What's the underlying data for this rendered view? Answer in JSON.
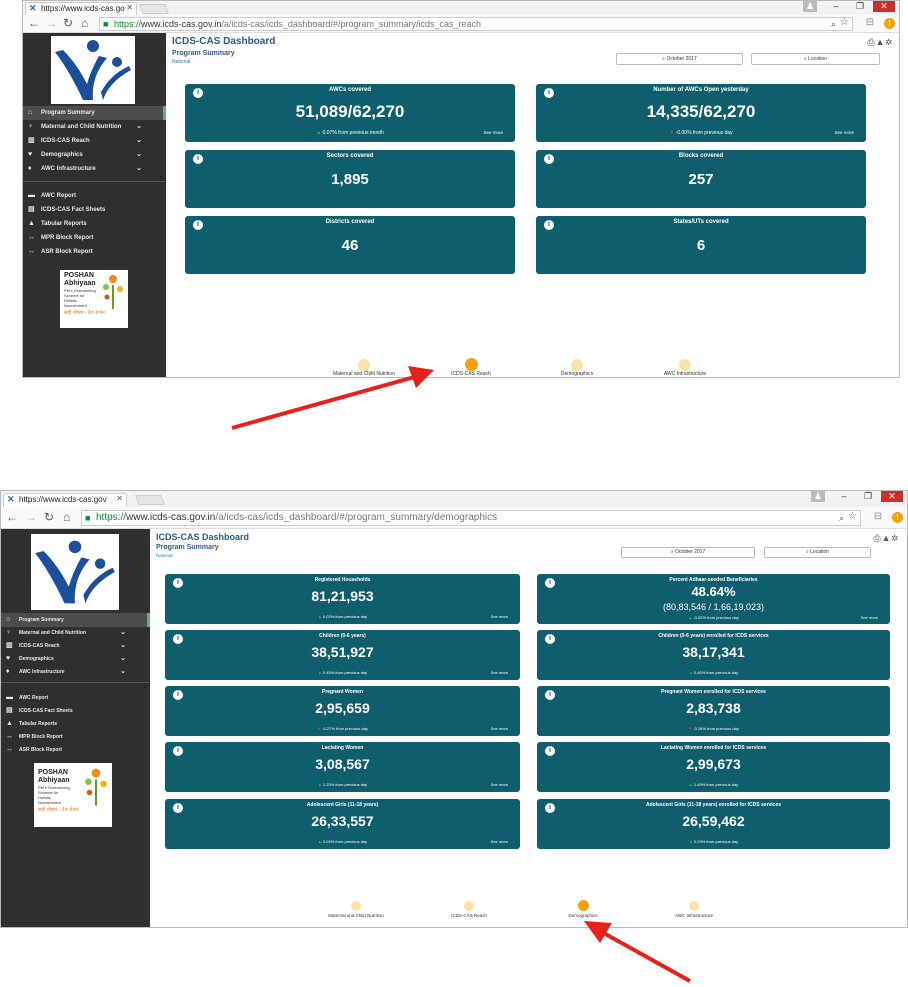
{
  "screenshots": [
    {
      "tab_title": "https://www.icds-cas.go",
      "url_https": "https://",
      "url_host": "www.icds-cas.gov.in",
      "url_path": "/a/icds-cas/icds_dashboard/#/program_summary/icds_cas_reach",
      "dashboard_title": "ICDS-CAS Dashboard",
      "section_title": "Program Summary",
      "level": "National",
      "month_filter": "October 2017",
      "location_filter": "Location",
      "cards": [
        {
          "title": "AWCs covered",
          "value": "51,089/62,270",
          "sub": "0.07% from previous month",
          "trend": "up",
          "more": "See more"
        },
        {
          "title": "Number of AWCs Open yesterday",
          "value": "14,335/62,270",
          "sub": "-0.00% from previous day",
          "trend": "down",
          "more": "See more"
        },
        {
          "title": "Sectors covered",
          "value": "1,895"
        },
        {
          "title": "Blocks covered",
          "value": "257"
        },
        {
          "title": "Districts covered",
          "value": "46"
        },
        {
          "title": "States/UTs covered",
          "value": "6"
        }
      ],
      "bubbles": [
        "Maternal and Child Nutrition",
        "ICDS-CAS Reach",
        "Demographics",
        "AWC Infrastructure"
      ],
      "active_bubble": 1
    },
    {
      "tab_title": "https://www.icds-cas.gov",
      "url_https": "https://",
      "url_host": "www.icds-cas.gov.in",
      "url_path": "/a/icds-cas/icds_dashboard/#/program_summary/demographics",
      "dashboard_title": "ICDS-CAS Dashboard",
      "section_title": "Program Summary",
      "level": "National",
      "month_filter": "October 2017",
      "location_filter": "Location",
      "cards": [
        {
          "title": "Registered Households",
          "value": "81,21,953",
          "sub": "0.02% from previous day",
          "trend": "up",
          "more": "See more"
        },
        {
          "title": "Percent Adhaar-seeded Beneficiaries",
          "value": "48.64%",
          "extra": "(80,83,546 / 1,66,19,023)",
          "sub": "-0.02% from previous day",
          "trend": "up",
          "more": "See more"
        },
        {
          "title": "Children (0-6 years)",
          "value": "38,51,927",
          "sub": "0.45% from previous day",
          "trend": "up",
          "more": "See more"
        },
        {
          "title": "Children (0-6 years) enrolled for ICDS services",
          "value": "38,17,341",
          "sub": "0.46% from previous day",
          "trend": "up"
        },
        {
          "title": "Pregnant Women",
          "value": "2,95,659",
          "sub": "-0.27% from previous day",
          "trend": "down",
          "more": "See more"
        },
        {
          "title": "Pregnant Women enrolled for ICDS services",
          "value": "2,83,738",
          "sub": "-0.26% from previous day",
          "trend": "down"
        },
        {
          "title": "Lactating Women",
          "value": "3,08,567",
          "sub": "1.23% from previous day",
          "trend": "up",
          "more": "See more"
        },
        {
          "title": "Lactating Women enrolled for ICDS services",
          "value": "2,99,673",
          "sub": "1.49% from previous day",
          "trend": "up"
        },
        {
          "title": "Adolescent Girls (11-18 years)",
          "value": "26,33,557",
          "sub": "0.03% from previous day",
          "trend": "up",
          "more": "See more"
        },
        {
          "title": "Adolescent Girls (11-18 years) enrolled for ICDS services",
          "value": "26,59,462",
          "sub": "0.03% from previous day",
          "trend": "up"
        }
      ],
      "bubbles": [
        "Maternal and Child Nutrition",
        "ICDS-CAS Reach",
        "Demographics",
        "AWC Infrastructure"
      ],
      "active_bubble": 2
    }
  ],
  "sidebar": {
    "items": [
      {
        "label": "Program Summary",
        "icon": "home-icon",
        "glyph": "⌂",
        "chevron": false
      },
      {
        "label": "Maternal and Child Nutrition",
        "icon": "child-icon",
        "glyph": "♀",
        "chevron": true
      },
      {
        "label": "ICDS-CAS Reach",
        "icon": "bar-chart-icon",
        "glyph": "▥",
        "chevron": true
      },
      {
        "label": "Demographics",
        "icon": "users-icon",
        "glyph": "♥",
        "chevron": true
      },
      {
        "label": "AWC Infrastructure",
        "icon": "pin-icon",
        "glyph": "♦",
        "chevron": true
      }
    ],
    "reports": [
      {
        "label": "AWC Report",
        "icon": "report-icon",
        "glyph": "▬"
      },
      {
        "label": "ICDS-CAS Fact Sheets",
        "icon": "file-icon",
        "glyph": "▤"
      },
      {
        "label": "Tabular Reports",
        "icon": "person-icon",
        "glyph": "▲"
      },
      {
        "label": "MPR Block Report",
        "icon": "link-icon",
        "glyph": "↔"
      },
      {
        "label": "ASR Block Report",
        "icon": "link-icon",
        "glyph": "↔"
      }
    ]
  },
  "poshan": {
    "line1": "POSHAN",
    "line2": "Abhiyaan",
    "line3": "PM's Overarching Scheme for Holistic Nourishment",
    "line4": "सही पोषण - देश रोशन"
  },
  "colors": {
    "card": "#0e5e6e",
    "sidebar": "#2f2f2f",
    "title": "#2a5a8c",
    "bubble_active": "#f5a20a",
    "bubble": "#fbe3a6",
    "arrow": "#e8201a"
  }
}
